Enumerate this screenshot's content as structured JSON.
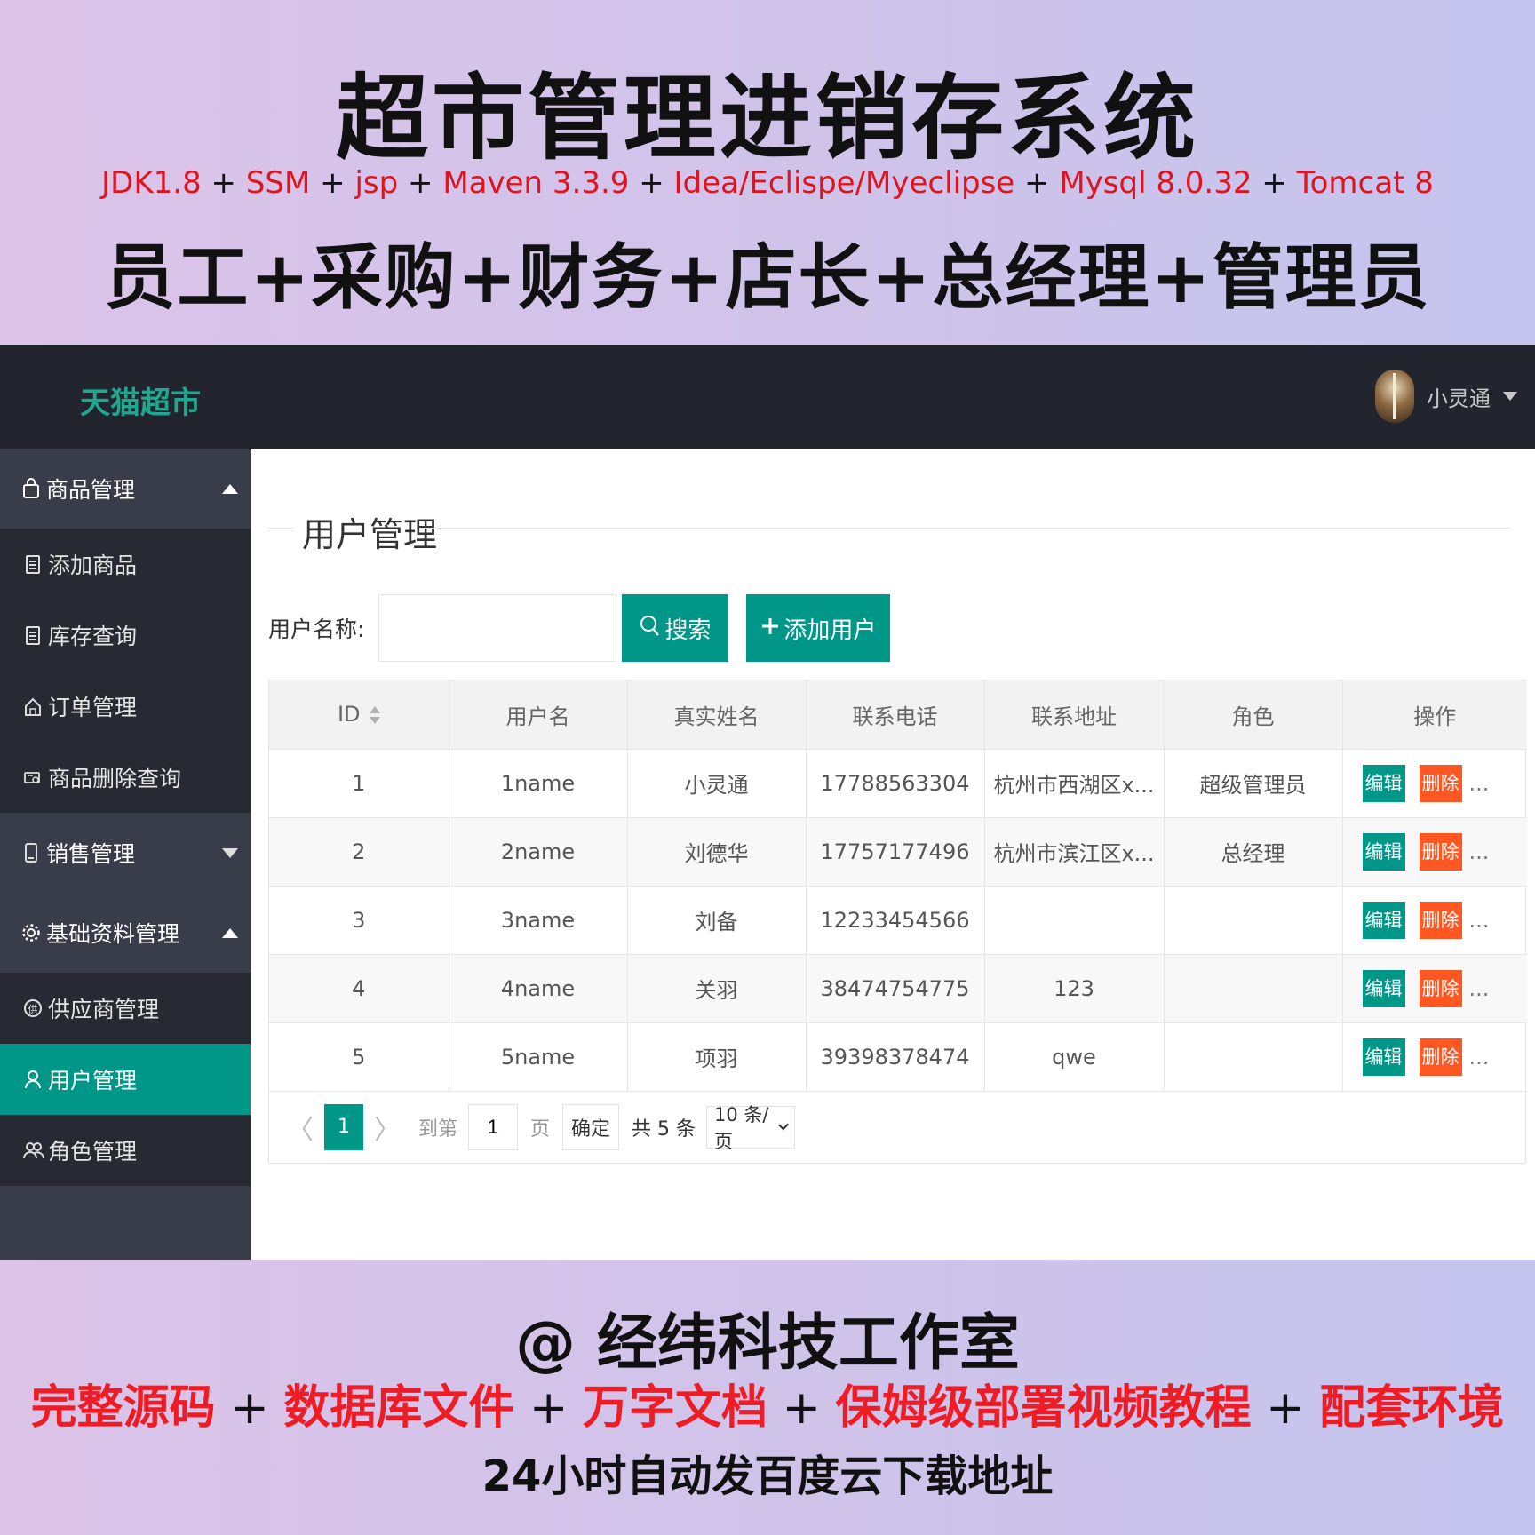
{
  "banner": {
    "title": "超市管理进销存系统",
    "tech_parts": [
      "JDK1.8",
      "SSM",
      "jsp",
      "Maven 3.3.9",
      "Idea/Eclispe/Myeclipse",
      "Mysql 8.0.32",
      "Tomcat 8"
    ],
    "plus": "+",
    "roles": "员工+采购+财务+店长+总经理+管理员",
    "studio": "@ 经纬科技工作室",
    "offers": [
      "完整源码",
      "数据库文件",
      "万字文档",
      "保姆级部署视频教程",
      "配套环境"
    ],
    "delivery": "24小时自动发百度云下载地址"
  },
  "header": {
    "logo": "天猫超市",
    "username": "小灵通"
  },
  "sidebar": {
    "groups": [
      {
        "label": "商品管理",
        "icon": "bag-icon",
        "expanded": true,
        "items": [
          {
            "label": "添加商品",
            "icon": "clipboard-icon"
          },
          {
            "label": "库存查询",
            "icon": "clipboard-icon"
          },
          {
            "label": "订单管理",
            "icon": "home-icon"
          },
          {
            "label": "商品删除查询",
            "icon": "card-search-icon"
          }
        ]
      },
      {
        "label": "销售管理",
        "icon": "phone-icon",
        "expanded": false,
        "items": []
      },
      {
        "label": "基础资料管理",
        "icon": "gear-icon",
        "expanded": true,
        "items": [
          {
            "label": "供应商管理",
            "icon": "supplier-icon"
          },
          {
            "label": "用户管理",
            "icon": "user-icon",
            "active": true
          },
          {
            "label": "角色管理",
            "icon": "users-icon"
          }
        ]
      }
    ]
  },
  "main": {
    "section_title": "用户管理",
    "search_label": "用户名称:",
    "search_placeholder": "",
    "search_button": "搜索",
    "add_button": "添加用户",
    "columns": [
      "ID",
      "用户名",
      "真实姓名",
      "联系电话",
      "联系地址",
      "角色",
      "操作"
    ],
    "rows": [
      {
        "id": "1",
        "username": "1name",
        "realname": "小灵通",
        "phone": "17788563304",
        "address": "杭州市西湖区x...",
        "role": "超级管理员"
      },
      {
        "id": "2",
        "username": "2name",
        "realname": "刘德华",
        "phone": "17757177496",
        "address": "杭州市滨江区x...",
        "role": "总经理"
      },
      {
        "id": "3",
        "username": "3name",
        "realname": "刘备",
        "phone": "12233454566",
        "address": "",
        "role": ""
      },
      {
        "id": "4",
        "username": "4name",
        "realname": "关羽",
        "phone": "38474754775",
        "address": "123",
        "role": ""
      },
      {
        "id": "5",
        "username": "5name",
        "realname": "项羽",
        "phone": "39398378474",
        "address": "qwe",
        "role": ""
      }
    ],
    "row_actions": {
      "edit": "编辑",
      "delete": "删除",
      "more": "..."
    },
    "pager": {
      "prev": "〈",
      "next": "〉",
      "current": "1",
      "goto_label": "到第",
      "goto_value": "1",
      "page_label": "页",
      "confirm": "确定",
      "total": "共 5 条",
      "page_size": "10 条/页"
    }
  },
  "colors": {
    "header_bg": "#22252e",
    "sidebar_bg": "#393d49",
    "accent": "#009688",
    "danger": "#ff5722",
    "logo": "#1fa88f"
  }
}
